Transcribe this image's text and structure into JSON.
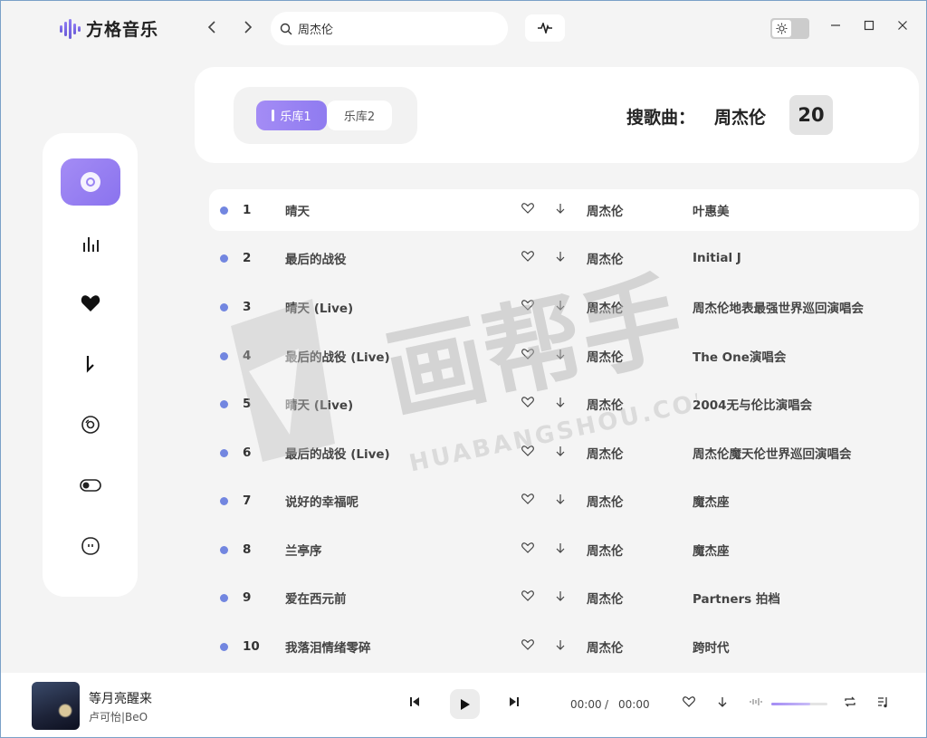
{
  "app": {
    "name": "方格音乐"
  },
  "titlebar": {
    "search_value": "周杰伦"
  },
  "header": {
    "tabs": [
      {
        "label": "乐库1",
        "active": true
      },
      {
        "label": "乐库2",
        "active": false
      }
    ],
    "search_label": "搜歌曲：",
    "search_query": "周杰伦",
    "result_count": "20"
  },
  "sidebar": {
    "items": [
      {
        "icon": "disc-icon",
        "active": true
      },
      {
        "icon": "chart-bars-icon",
        "active": false
      },
      {
        "icon": "heart-icon",
        "active": false
      },
      {
        "icon": "download-arrow-icon",
        "active": false
      },
      {
        "icon": "cd-icon",
        "active": false
      },
      {
        "icon": "toggle-icon",
        "active": false
      },
      {
        "icon": "face-icon",
        "active": false
      }
    ]
  },
  "songs": [
    {
      "num": "1",
      "title": "晴天",
      "artist": "周杰伦",
      "album": "叶惠美"
    },
    {
      "num": "2",
      "title": "最后的战役",
      "artist": "周杰伦",
      "album": "Initial J"
    },
    {
      "num": "3",
      "title": "晴天 (Live)",
      "artist": "周杰伦",
      "album": "周杰伦地表最强世界巡回演唱会"
    },
    {
      "num": "4",
      "title": "最后的战役 (Live)",
      "artist": "周杰伦",
      "album": "The One演唱会"
    },
    {
      "num": "5",
      "title": "晴天 (Live)",
      "artist": "周杰伦",
      "album": "2004无与伦比演唱会"
    },
    {
      "num": "6",
      "title": "最后的战役 (Live)",
      "artist": "周杰伦",
      "album": "周杰伦魔天伦世界巡回演唱会"
    },
    {
      "num": "7",
      "title": "说好的幸福呢",
      "artist": "周杰伦",
      "album": "魔杰座"
    },
    {
      "num": "8",
      "title": "兰亭序",
      "artist": "周杰伦",
      "album": "魔杰座"
    },
    {
      "num": "9",
      "title": "爱在西元前",
      "artist": "周杰伦",
      "album": "Partners 拍档"
    },
    {
      "num": "10",
      "title": "我落泪情绪零碎",
      "artist": "周杰伦",
      "album": "跨时代"
    }
  ],
  "player": {
    "title": "等月亮醒来",
    "artist": "卢可怡|BeO",
    "current_time": "00:00",
    "separator": "/",
    "total_time": "00:00",
    "volume": 0.7
  },
  "watermark": {
    "text": "画帮手",
    "url": "HUABANGSHOU.COM"
  },
  "colors": {
    "accent": "#9a84f3",
    "dot": "#7286e0"
  }
}
